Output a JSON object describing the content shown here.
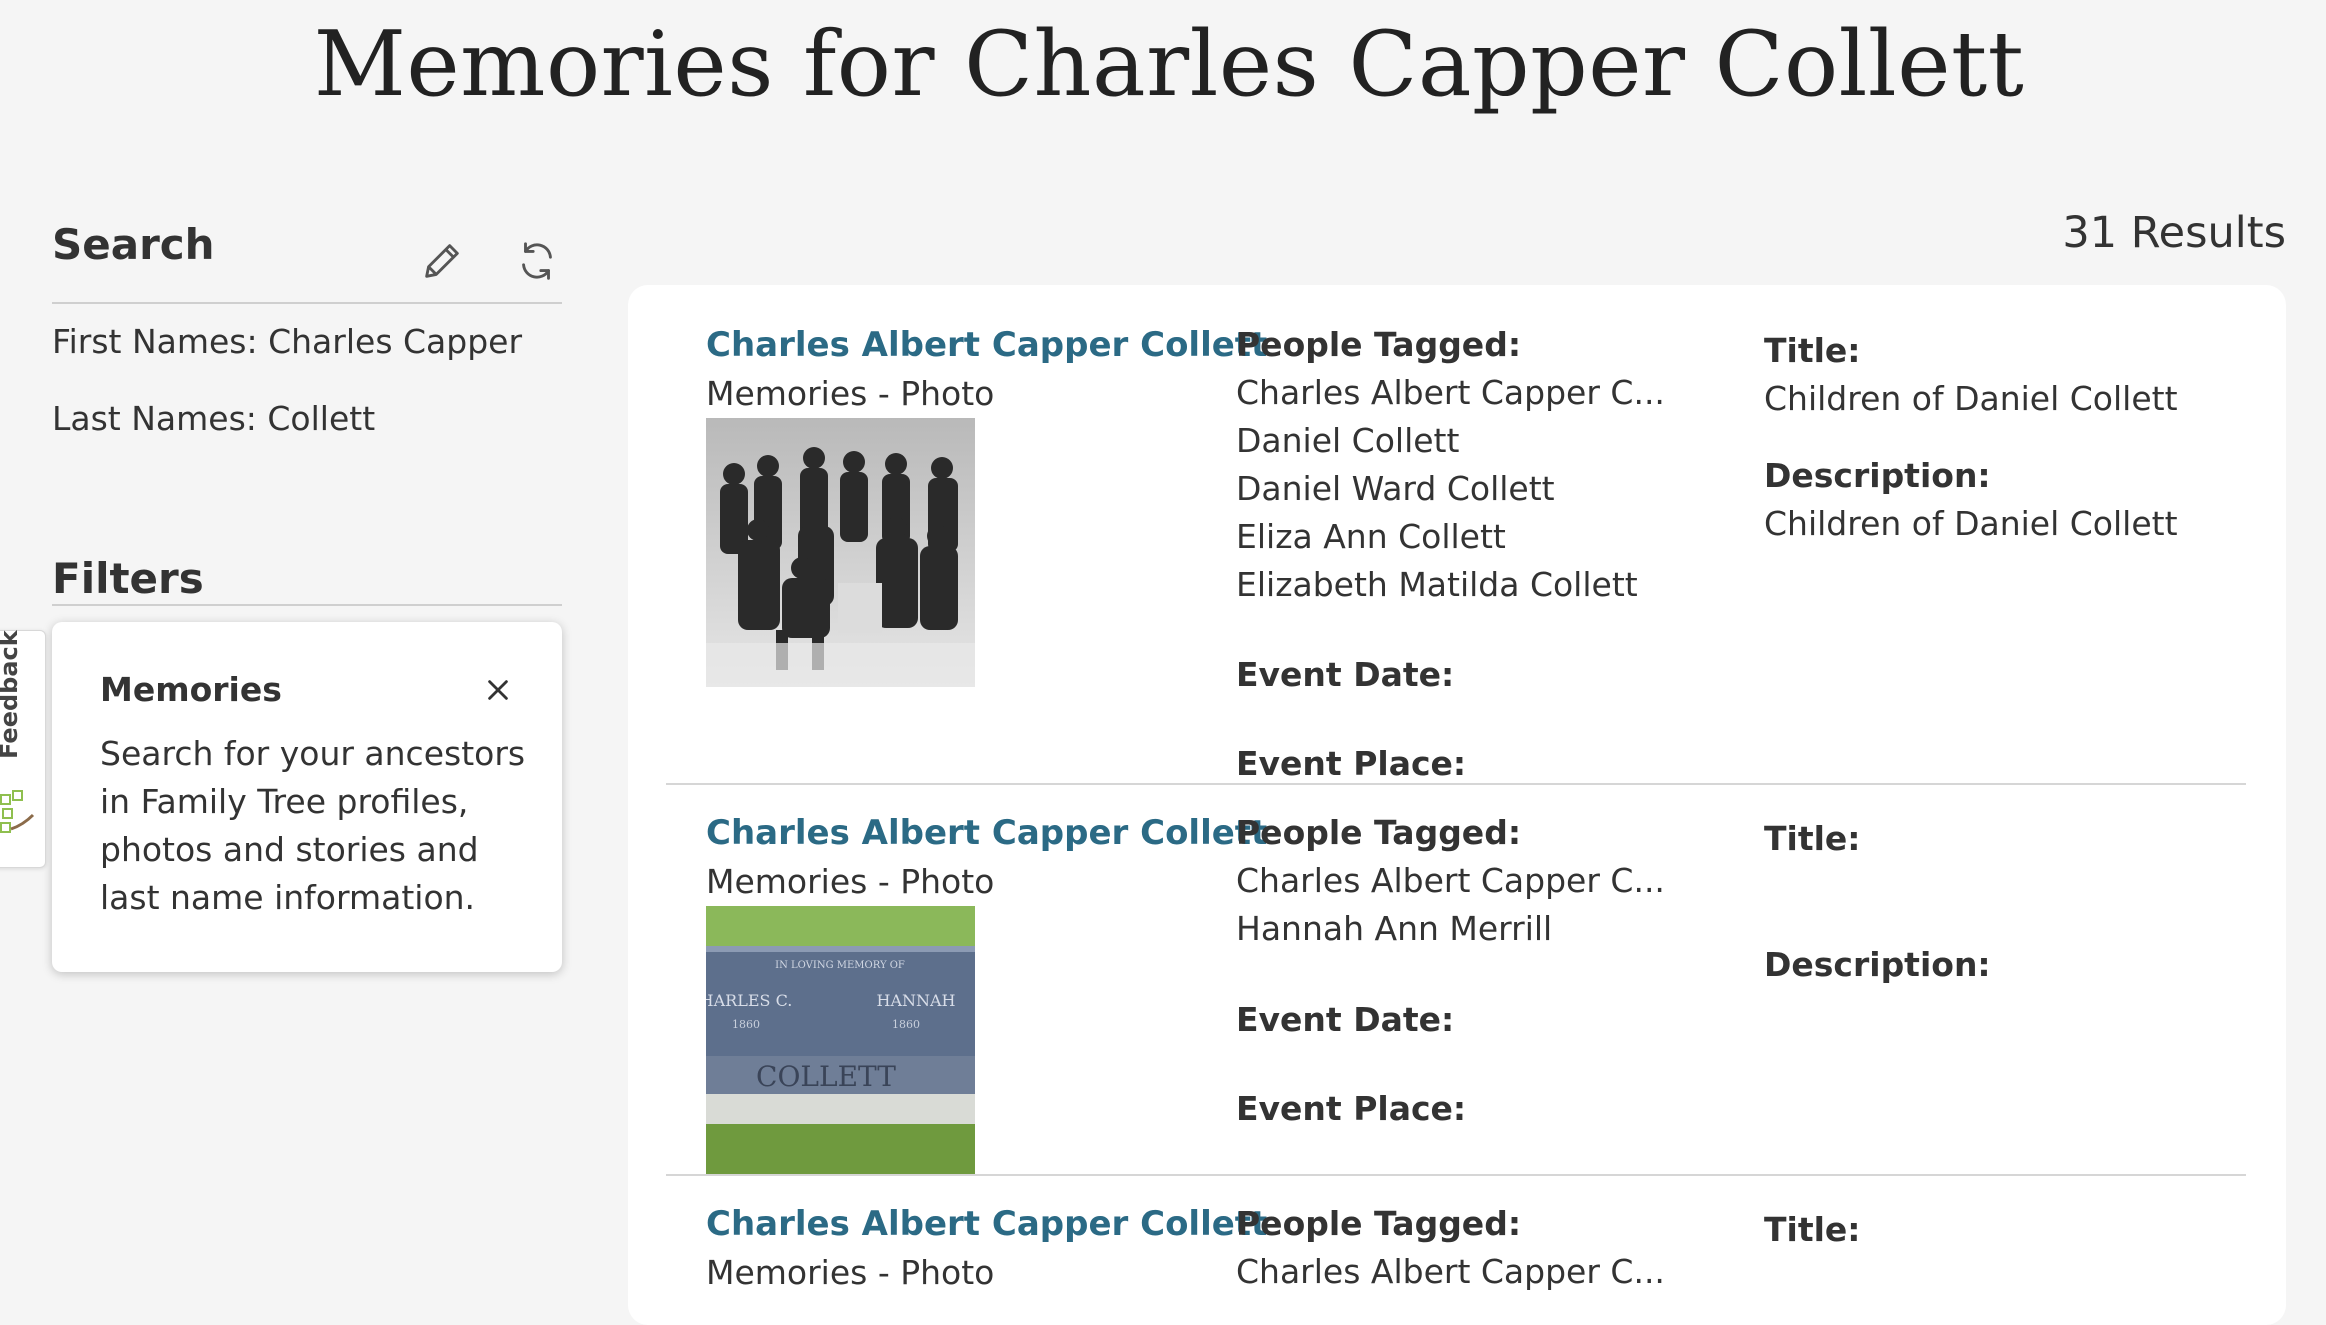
{
  "page": {
    "title": "Memories for Charles Capper Collett"
  },
  "sidebar": {
    "search_heading": "Search",
    "criteria": [
      {
        "text": "First Names: Charles Capper"
      },
      {
        "text": "Last Names: Collett"
      }
    ],
    "filters_heading": "Filters",
    "tooltip": {
      "title": "Memories",
      "body": "Search for your ancestors in Family Tree profiles, photos and stories and last name information."
    },
    "feedback_label": "Feedback"
  },
  "results": {
    "count": "31 Results",
    "labels": {
      "people_tagged": "People Tagged:",
      "event_date": "Event Date:",
      "event_place": "Event Place:",
      "title": "Title:",
      "description": "Description:"
    },
    "items": [
      {
        "name": "Charles Albert Capper Collett",
        "type": "Memories - Photo",
        "people": [
          "Charles Albert Capper C...",
          "Daniel Collett",
          "Daniel Ward Collett",
          "Eliza Ann Collett",
          "Elizabeth Matilda Collett"
        ],
        "title_value": "Children of Daniel Collett",
        "description_value": "Children of Daniel Collett"
      },
      {
        "name": "Charles Albert Capper Collett",
        "type": "Memories - Photo",
        "people": [
          "Charles Albert Capper C...",
          "Hannah Ann Merrill"
        ],
        "headstone_text": [
          "IN LOVING MEMORY OF",
          "HARLES C.",
          "HANNAH",
          "1860",
          "1860",
          "COLLETT"
        ]
      },
      {
        "name": "Charles Albert Capper Collett",
        "type": "Memories - Photo",
        "people": [
          "Charles Albert Capper C..."
        ]
      }
    ]
  }
}
